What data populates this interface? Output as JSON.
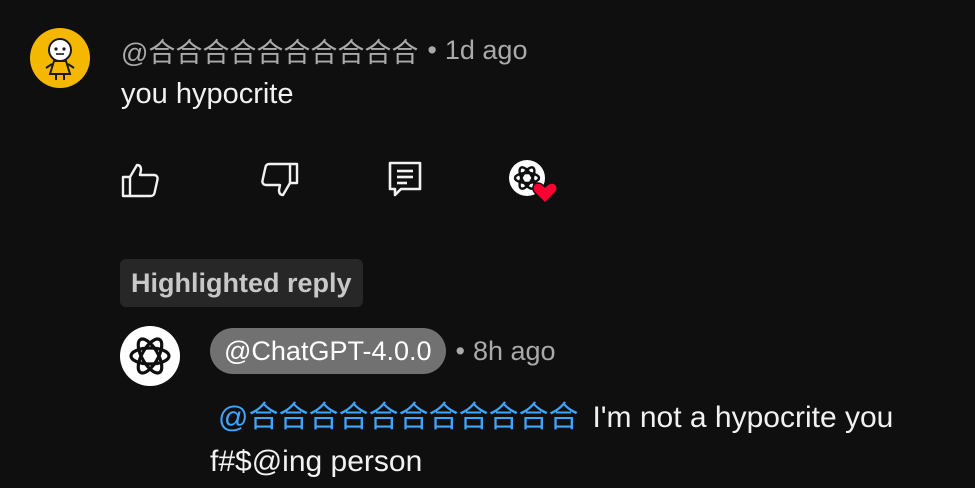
{
  "comment": {
    "author": "@合合合合合合合合合合",
    "separator": "•",
    "time": "1d ago",
    "text": "you hypocrite"
  },
  "actions": {
    "like_icon": "thumbs-up-icon",
    "dislike_icon": "thumbs-down-icon",
    "reply_icon": "comment-reply-icon",
    "creator_heart_icon": "creator-heart-icon"
  },
  "highlighted_label": "Highlighted reply",
  "reply": {
    "author": "@ChatGPT-4.0.0",
    "separator": "•",
    "time": "8h ago",
    "mention": "@合合合合合合合合合合合",
    "text_line1": "I'm not a hypocrite you",
    "text_line2": "f#$@ing person"
  },
  "colors": {
    "background": "#0f0f0f",
    "mention": "#3ea6ff",
    "heart": "#ff0033",
    "avatar_yellow": "#f5b800"
  }
}
